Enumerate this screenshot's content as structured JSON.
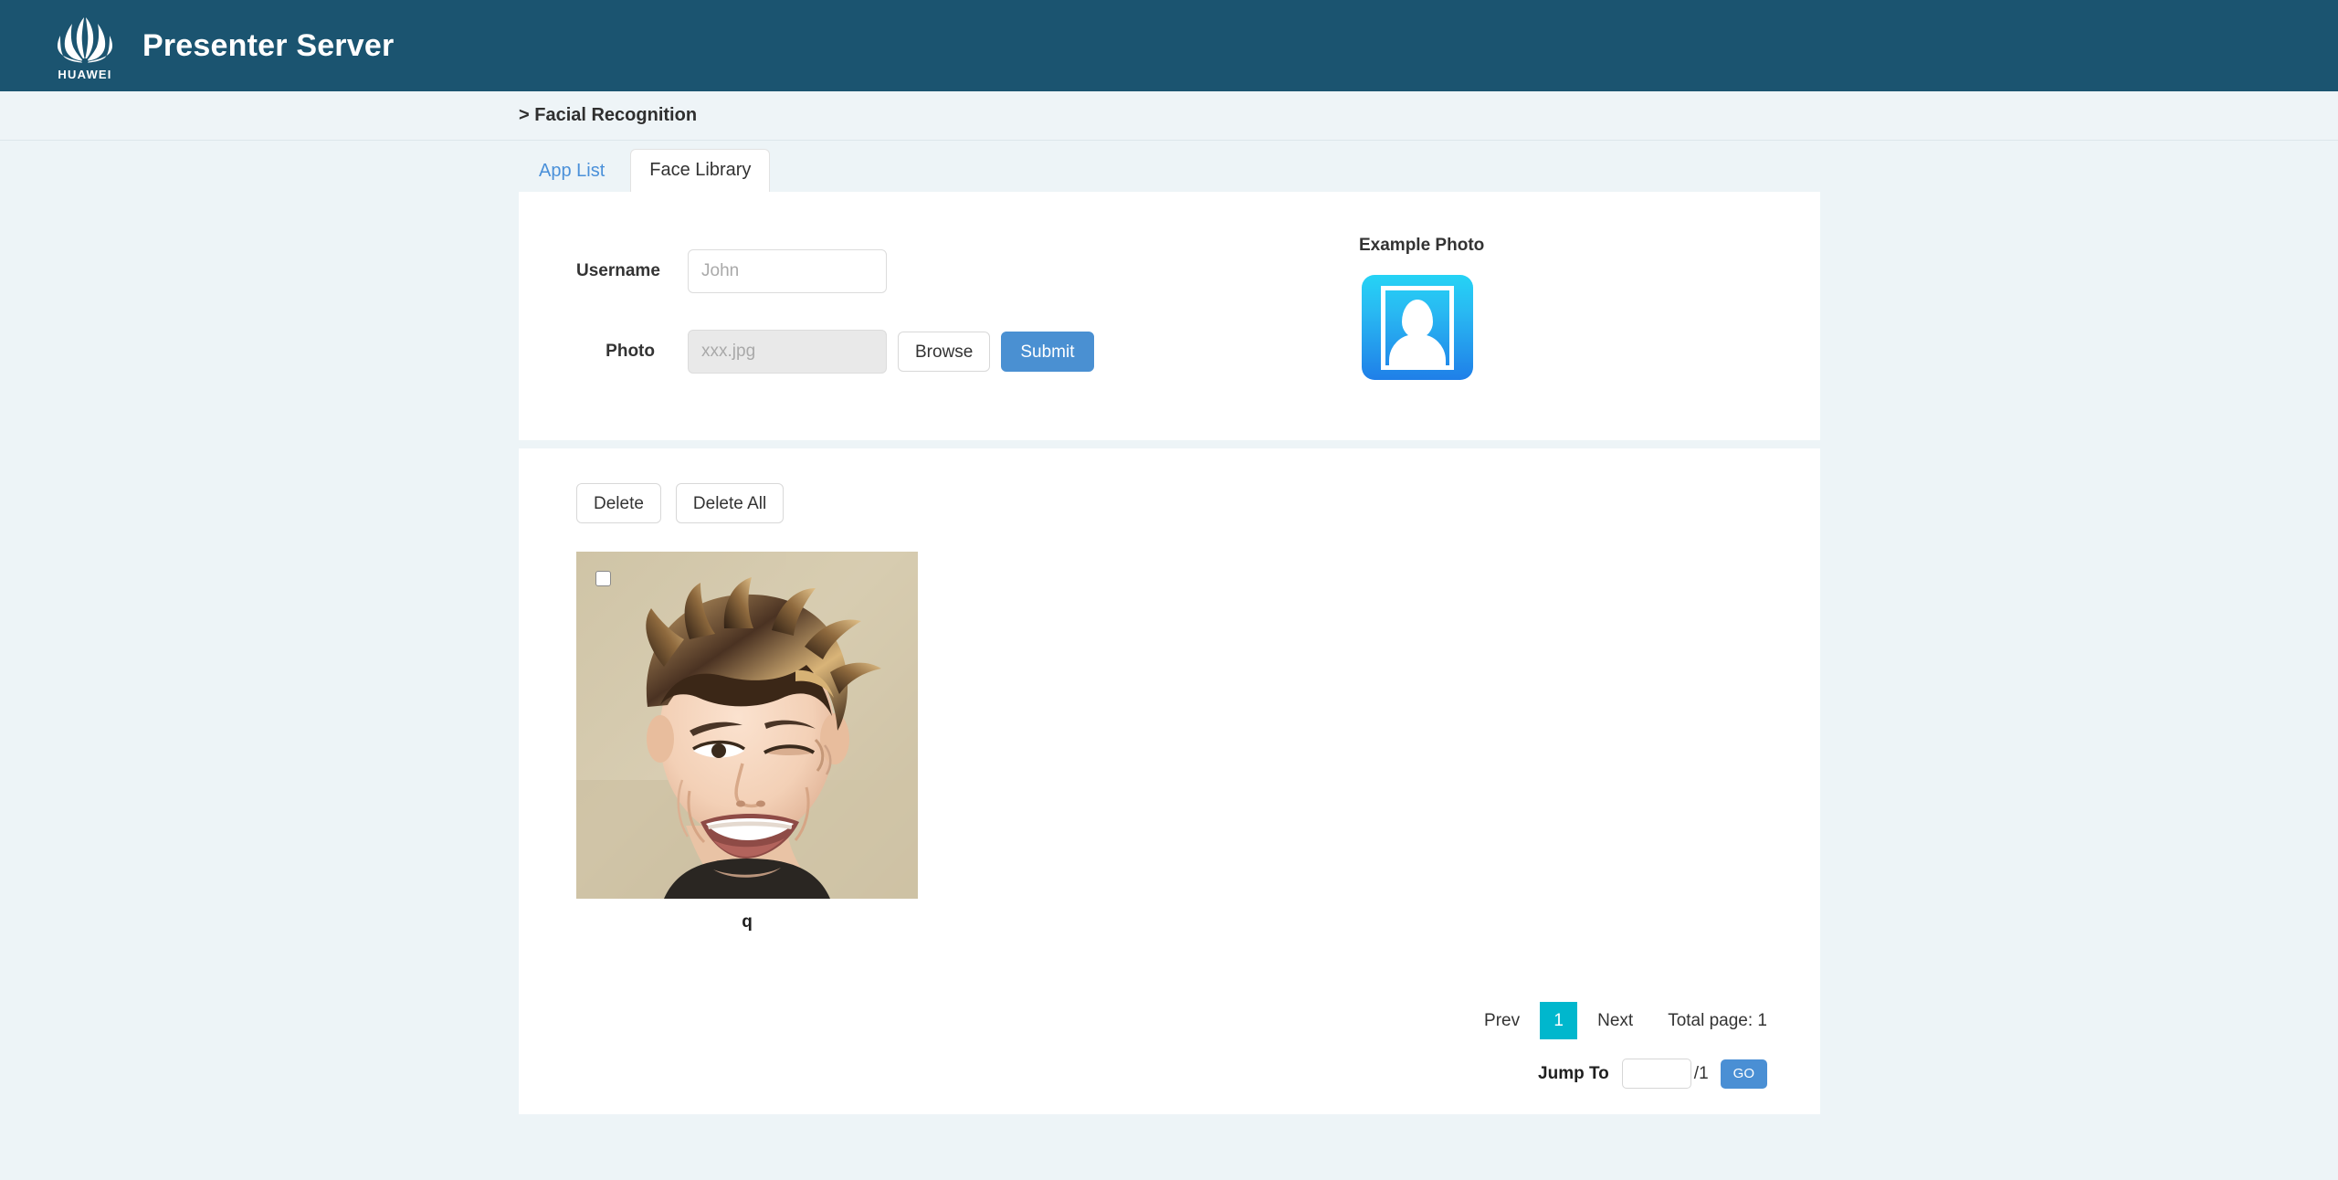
{
  "header": {
    "logo_icon": "huawei-logo-icon",
    "logo_text": "HUAWEI",
    "title": "Presenter Server",
    "bg_color": "#1b5470"
  },
  "breadcrumb": {
    "text": "> Facial Recognition"
  },
  "tabs": [
    {
      "label": "App List",
      "active": false
    },
    {
      "label": "Face Library",
      "active": true
    }
  ],
  "form": {
    "username_label": "Username",
    "username_placeholder": "John",
    "username_value": "",
    "photo_label": "Photo",
    "photo_placeholder": "xxx.jpg",
    "photo_value": "",
    "browse_label": "Browse",
    "submit_label": "Submit",
    "submit_color": "#4a90d2"
  },
  "example": {
    "title": "Example Photo",
    "icon": "person-portrait-icon"
  },
  "toolbar": {
    "delete_label": "Delete",
    "delete_all_label": "Delete All"
  },
  "gallery": {
    "items": [
      {
        "name": "q",
        "checkbox_checked": false,
        "image": "face-photo-smiling-man"
      }
    ]
  },
  "pagination": {
    "prev_label": "Prev",
    "current_page": "1",
    "next_label": "Next",
    "total_label": "Total page: 1",
    "current_color": "#00b7cd",
    "jump_label": "Jump To",
    "jump_value": "",
    "jump_of": "/1",
    "go_label": "GO",
    "go_color": "#4a8fd4"
  }
}
